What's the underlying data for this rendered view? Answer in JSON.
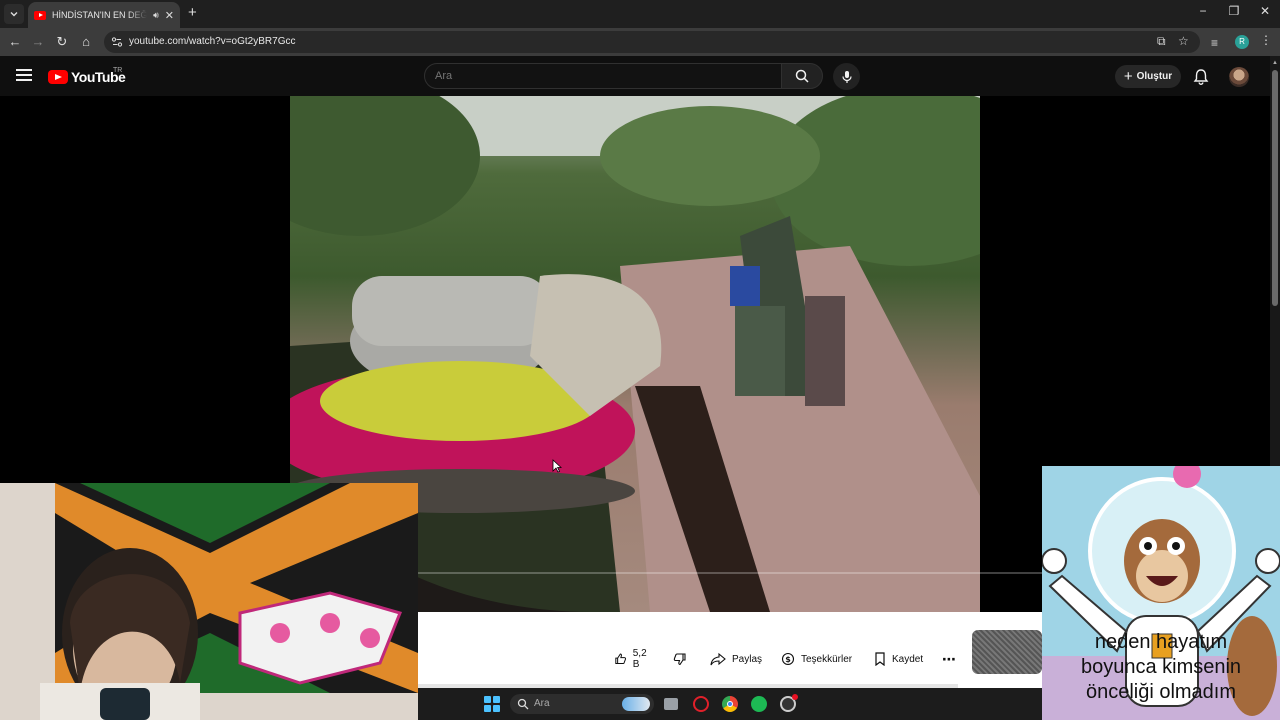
{
  "browser": {
    "tab": {
      "title": "HİNDİSTAN'IN EN DEĞERSİZ"
    },
    "url": "youtube.com/watch?v=oGt2yBR7Gcc",
    "profile_initial": "R"
  },
  "youtube": {
    "logo_text": "YouTube",
    "region": "TR",
    "search_placeholder": "Ara",
    "create_label": "Oluştur"
  },
  "actions": {
    "like_count": "5,2 B",
    "share_label": "Paylaş",
    "thanks_label": "Teşekkürler",
    "save_label": "Kaydet"
  },
  "taskbar": {
    "search_placeholder": "Ara"
  },
  "meme": {
    "caption_line1": "neden hayatım",
    "caption_line2": "boyunca kimsenin",
    "caption_line3": "önceliği olmadım"
  },
  "colors": {
    "youtube_red": "#ff0000",
    "page_bg": "#0f0f0f",
    "windows_accent": "#4cc2ff"
  }
}
